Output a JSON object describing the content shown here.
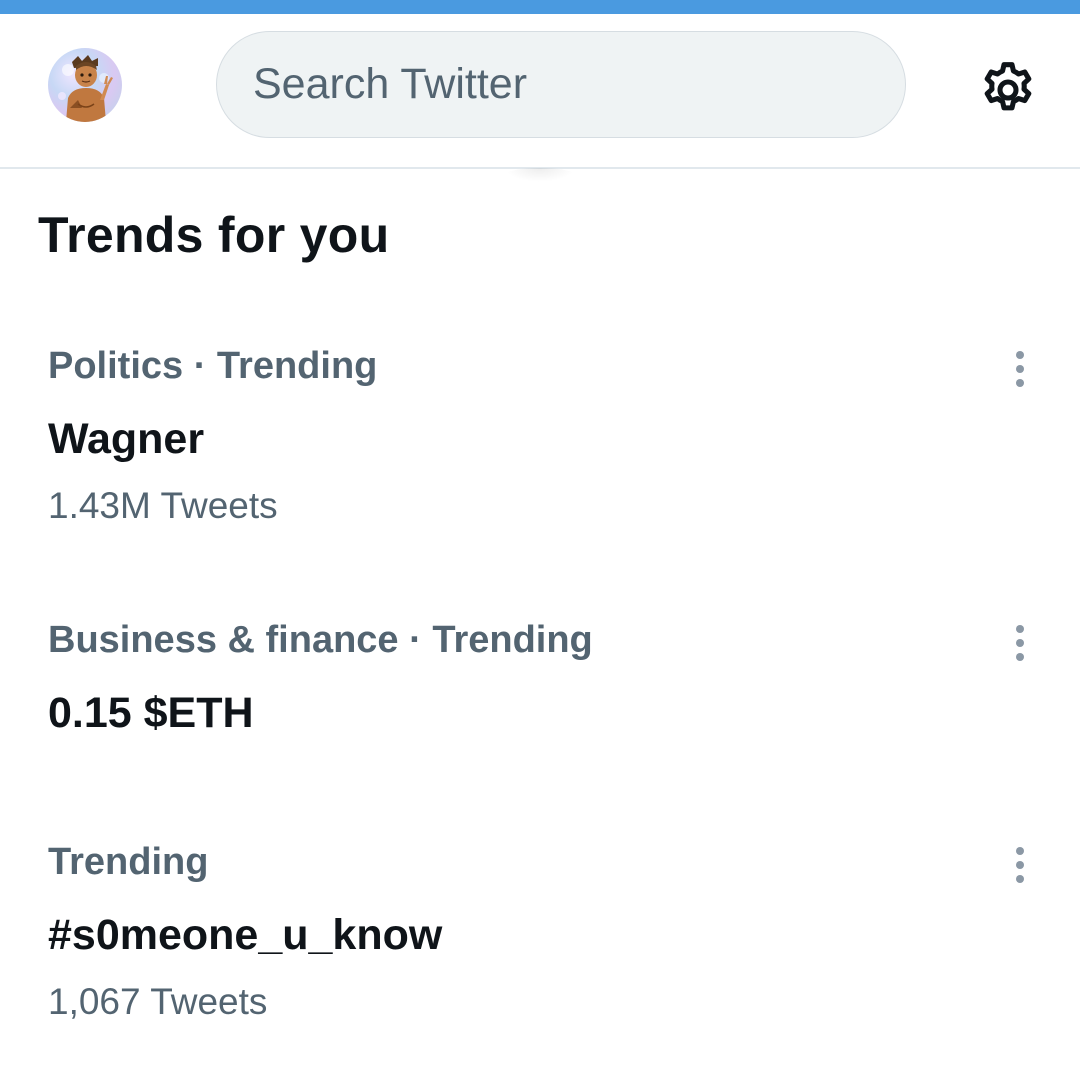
{
  "header": {
    "avatar_alt": "profile avatar",
    "search_placeholder": "Search Twitter",
    "settings_icon": "gear-icon"
  },
  "section": {
    "title": "Trends for you"
  },
  "trends": [
    {
      "meta": "Politics · Trending",
      "name": "Wagner",
      "count": "1.43M Tweets"
    },
    {
      "meta": "Business & finance · Trending",
      "name": "0.15 $ETH",
      "count": ""
    },
    {
      "meta": "Trending",
      "name": "#s0meone_u_know",
      "count": "1,067 Tweets"
    }
  ],
  "colors": {
    "accent": "#4a9ae0",
    "primary_text": "#0f1419",
    "secondary_text": "#536471",
    "search_bg": "#eff3f4"
  }
}
